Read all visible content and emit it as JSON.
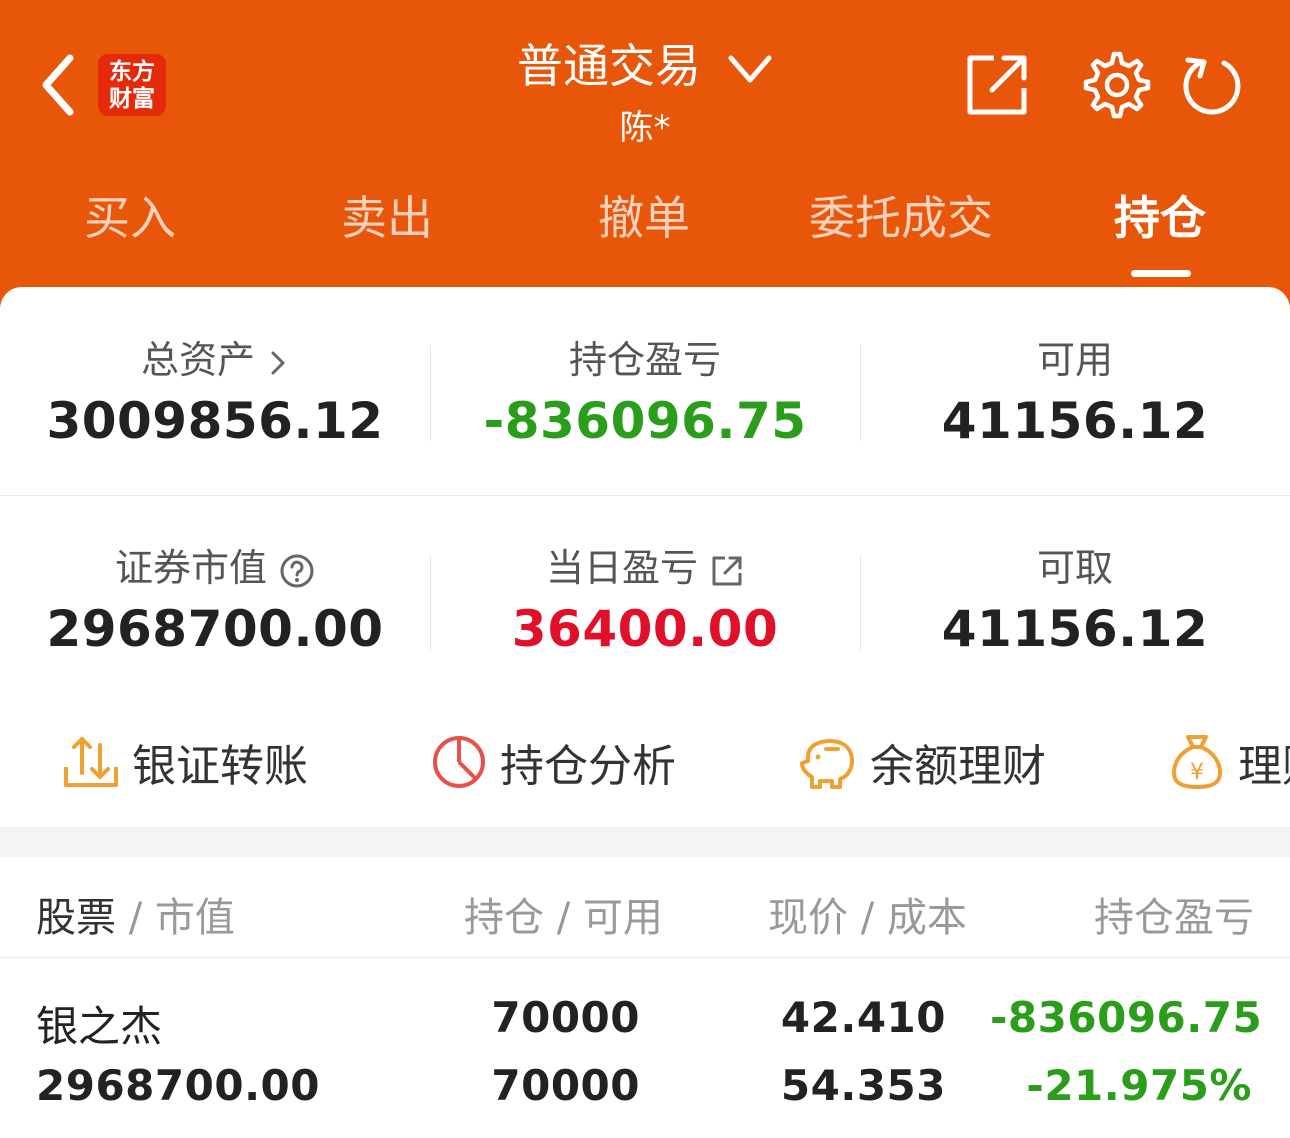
{
  "header": {
    "logo_line1": "东方",
    "logo_line2": "财富",
    "title": "普通交易",
    "subtitle": "陈*",
    "bg_color": "#e85609"
  },
  "tabs": [
    {
      "label": "买入",
      "active": false
    },
    {
      "label": "卖出",
      "active": false
    },
    {
      "label": "撤单",
      "active": false
    },
    {
      "label": "委托成交",
      "active": false
    },
    {
      "label": "持仓",
      "active": true
    }
  ],
  "summary": {
    "total_assets_label": "总资产",
    "total_assets": "3009856.12",
    "position_pnl_label": "持仓盈亏",
    "position_pnl": "-836096.75",
    "available_label": "可用",
    "available": "41156.12",
    "market_value_label": "证券市值",
    "market_value": "2968700.00",
    "daily_pnl_label": "当日盈亏",
    "daily_pnl": "36400.00",
    "withdrawable_label": "可取",
    "withdrawable": "41156.12"
  },
  "quick_actions": [
    {
      "label": "银证转账",
      "icon": "transfer-icon"
    },
    {
      "label": "持仓分析",
      "icon": "pie-chart-icon"
    },
    {
      "label": "余额理财",
      "icon": "piggy-bank-icon"
    },
    {
      "label": "理财",
      "icon": "money-bag-icon"
    }
  ],
  "holdings_header": {
    "col1_main": "股票",
    "col1_sub": "市值",
    "col2_main": "持仓",
    "col2_sub": "可用",
    "col3_main": "现价",
    "col3_sub": "成本",
    "col4": "持仓盈亏"
  },
  "holdings": [
    {
      "name": "银之杰",
      "market_value": "2968700.00",
      "position": "70000",
      "available": "70000",
      "price": "42.410",
      "cost": "54.353",
      "pnl": "-836096.75",
      "pnl_pct": "-21.975%"
    }
  ],
  "colors": {
    "accent": "#e85609",
    "loss": "#2a9d1a",
    "gain": "#e0102a",
    "icon_orange": "#f0a030",
    "icon_red": "#e8504a"
  }
}
